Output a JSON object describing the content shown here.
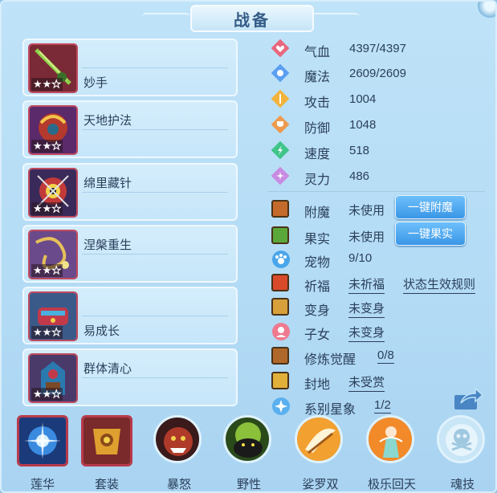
{
  "title": "战备",
  "skills": [
    {
      "name": "妙手",
      "stars": 2,
      "max_stars": 3,
      "icon": "jade-sword-icon"
    },
    {
      "name": "天地护法",
      "stars": 2,
      "max_stars": 3,
      "icon": "guardian-armor-icon"
    },
    {
      "name": "绵里藏针",
      "stars": 2,
      "max_stars": 3,
      "icon": "hidden-needle-icon"
    },
    {
      "name": "涅槃重生",
      "stars": 2,
      "max_stars": 3,
      "icon": "rebirth-chain-icon"
    },
    {
      "name": "易成长",
      "stars": 2,
      "max_stars": 3,
      "icon": "growth-box-icon"
    },
    {
      "name": "群体清心",
      "stars": 2,
      "max_stars": 3,
      "icon": "purify-totem-icon"
    }
  ],
  "stats": [
    {
      "label": "气血",
      "value": "4397/4397",
      "icon": "heart-icon",
      "color": "#e8677e"
    },
    {
      "label": "魔法",
      "value": "2609/2609",
      "icon": "magic-icon",
      "color": "#5b9ff0"
    },
    {
      "label": "攻击",
      "value": "1004",
      "icon": "attack-icon",
      "color": "#f2b33c"
    },
    {
      "label": "防御",
      "value": "1048",
      "icon": "defense-icon",
      "color": "#ee9a4e"
    },
    {
      "label": "速度",
      "value": "518",
      "icon": "speed-icon",
      "color": "#3fc48a"
    },
    {
      "label": "灵力",
      "value": "486",
      "icon": "spirit-icon",
      "color": "#c88be3"
    }
  ],
  "props": {
    "enchant": {
      "label": "附魔",
      "value": "未使用",
      "button": "一键附魔"
    },
    "fruit": {
      "label": "果实",
      "value": "未使用",
      "button": "一键果实"
    },
    "pet": {
      "label": "宠物",
      "value": "9/10"
    },
    "blessing": {
      "label": "祈福",
      "value": "未祈福",
      "link": "状态生效规则"
    },
    "transform": {
      "label": "变身",
      "value": "未变身"
    },
    "child": {
      "label": "子女",
      "value": "未变身"
    },
    "cultivate": {
      "label": "修炼觉醒",
      "value": "0/8"
    },
    "fief": {
      "label": "封地",
      "value": "未受赏"
    },
    "constellation": {
      "label": "系别星象",
      "value": "1/2"
    }
  },
  "tabs": [
    {
      "label": "莲华",
      "icon": "lotus-orb-icon"
    },
    {
      "label": "套装",
      "icon": "armor-set-icon"
    },
    {
      "label": "暴怒",
      "icon": "rage-beast-icon"
    },
    {
      "label": "野性",
      "icon": "wild-beast-icon"
    },
    {
      "label": "娑罗双",
      "icon": "sal-tree-icon"
    },
    {
      "label": "极乐回天",
      "icon": "bliss-fairy-icon"
    },
    {
      "label": "魂技",
      "icon": "soul-skill-icon"
    }
  ]
}
